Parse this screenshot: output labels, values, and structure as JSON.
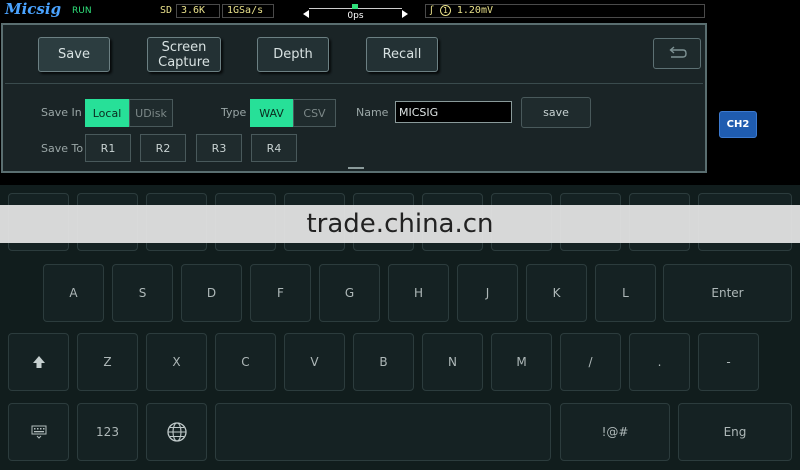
{
  "status_bar": {
    "brand": "Micsig",
    "run_state": "RUN",
    "mode": "SD",
    "memory_depth": "3.6K",
    "sample_rate": "1GSa/s",
    "trigger_offset": "0ps",
    "trigger_level": "1.20mV",
    "trigger_source": "1"
  },
  "tabs": [
    {
      "label": "Save"
    },
    {
      "label": "Screen\nCapture"
    },
    {
      "label": "Depth"
    },
    {
      "label": "Recall"
    }
  ],
  "save_in": {
    "label": "Save In",
    "options": [
      "Local",
      "UDisk"
    ],
    "selected": "Local"
  },
  "type": {
    "label": "Type",
    "options": [
      "WAV",
      "CSV"
    ],
    "selected": "WAV"
  },
  "name": {
    "label": "Name",
    "value": "MICSIG"
  },
  "save_button": "save",
  "save_to": {
    "label": "Save To",
    "options": [
      "R1",
      "R2",
      "R3",
      "R4"
    ]
  },
  "channel_badge": "CH2",
  "keyboard": {
    "row_home": [
      "A",
      "S",
      "D",
      "F",
      "G",
      "H",
      "J",
      "K",
      "L"
    ],
    "enter": "Enter",
    "row_bottom": [
      "Z",
      "X",
      "C",
      "V",
      "B",
      "N",
      "M",
      "/",
      ".",
      "-"
    ],
    "numbers_key": "123",
    "symbols_key": "!@#",
    "lang_key": "Eng"
  },
  "watermark": "trade.china.cn",
  "colors": {
    "accent_green": "#27e098",
    "brand_blue": "#4aa3ff",
    "status_yellow": "#e8e08a",
    "channel_blue": "#1f5cb0"
  }
}
